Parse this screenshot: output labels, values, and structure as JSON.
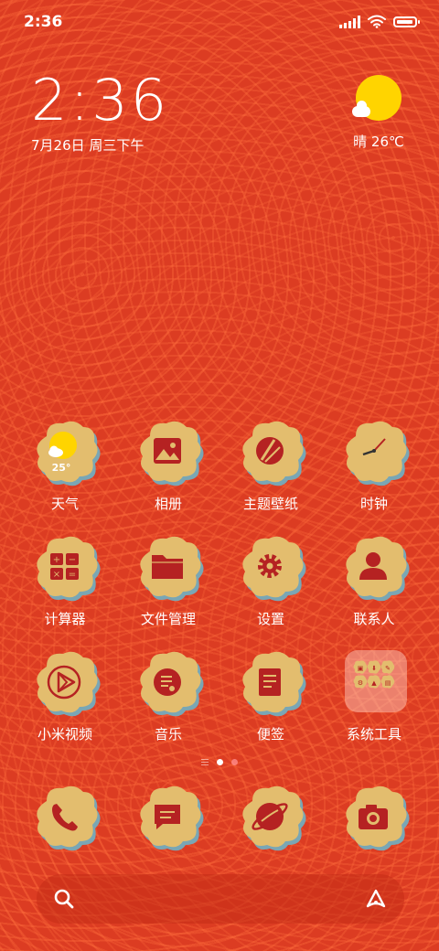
{
  "status_bar": {
    "time": "2:36",
    "battery_level": 0.92
  },
  "clock_widget": {
    "time": "2:36",
    "date": "7月26日 周三下午"
  },
  "weather_widget": {
    "text": "晴 26℃"
  },
  "apps": [
    {
      "label": "天气",
      "icon": "weather-icon",
      "badge": "25°"
    },
    {
      "label": "相册",
      "icon": "gallery-icon"
    },
    {
      "label": "主题壁纸",
      "icon": "themes-icon"
    },
    {
      "label": "时钟",
      "icon": "clock-icon"
    },
    {
      "label": "计算器",
      "icon": "calculator-icon"
    },
    {
      "label": "文件管理",
      "icon": "folder-icon"
    },
    {
      "label": "设置",
      "icon": "gear-icon"
    },
    {
      "label": "联系人",
      "icon": "contacts-icon"
    },
    {
      "label": "小米视频",
      "icon": "video-icon"
    },
    {
      "label": "音乐",
      "icon": "music-icon"
    },
    {
      "label": "便签",
      "icon": "notes-icon"
    },
    {
      "label": "系统工具",
      "icon": "system-tools-folder-icon"
    }
  ],
  "dock": [
    {
      "icon": "phone-icon"
    },
    {
      "icon": "messages-icon"
    },
    {
      "icon": "browser-icon"
    },
    {
      "icon": "camera-icon"
    }
  ],
  "page_indicator": {
    "pages": 2,
    "current": 1
  },
  "colors": {
    "background": "#dc3c22",
    "icon_gold": "#e3bd6e",
    "icon_shadow": "#7aa6b4",
    "glyph_red": "#b52222",
    "sun_yellow": "#ffd400"
  }
}
